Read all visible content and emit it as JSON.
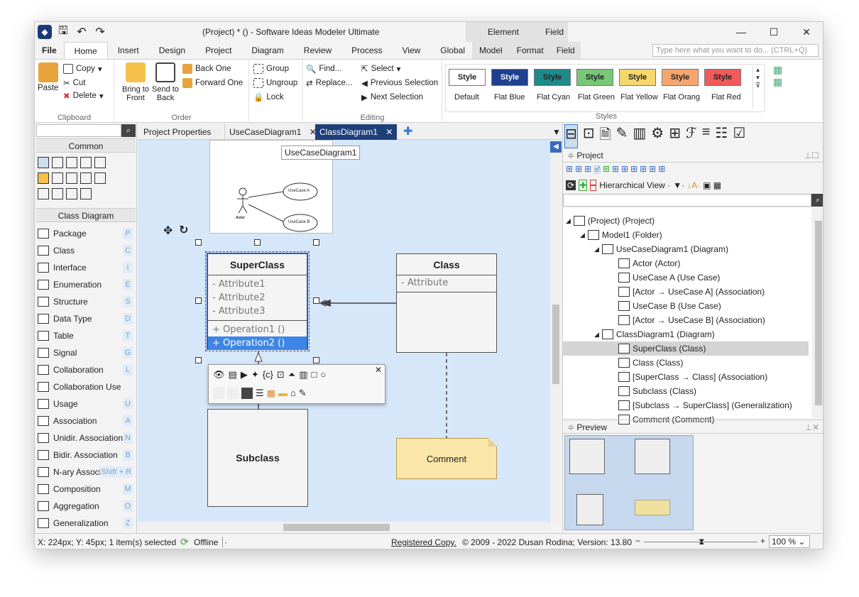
{
  "window": {
    "title": "(Project) * () - Software Ideas Modeler Ultimate",
    "context_element": "Element",
    "context_field": "Field"
  },
  "tabs": [
    "File",
    "Home",
    "Insert",
    "Design",
    "Project",
    "Diagram",
    "Review",
    "Process",
    "View",
    "Global",
    "Model",
    "Format",
    "Field"
  ],
  "search_placeholder": "Type here what you want to do... (CTRL+Q)",
  "ribbon": {
    "clipboard": {
      "paste": "Paste",
      "copy": "Copy",
      "cut": "Cut",
      "delete": "Delete",
      "label": "Clipboard"
    },
    "order": {
      "bring_front": "Bring to Front",
      "send_back": "Send to Back",
      "back_one": "Back One",
      "forward_one": "Forward One",
      "label": "Order"
    },
    "group": {
      "group": "Group",
      "ungroup": "Ungroup",
      "lock": "Lock"
    },
    "editing": {
      "find": "Find...",
      "replace": "Replace...",
      "select": "Select",
      "prev_sel": "Previous Selection",
      "next_sel": "Next Selection",
      "label": "Editing"
    },
    "styles": {
      "label": "Styles",
      "button_text": "Style",
      "items": [
        {
          "name": "Default",
          "bg": "#ffffff",
          "fg": "#222222"
        },
        {
          "name": "Flat Blue",
          "bg": "#1f3f8f",
          "fg": "#ffffff"
        },
        {
          "name": "Flat Cyan",
          "bg": "#1f8a8a",
          "fg": "#222222"
        },
        {
          "name": "Flat Green",
          "bg": "#77c777",
          "fg": "#222222"
        },
        {
          "name": "Flat Yellow",
          "bg": "#f5d76e",
          "fg": "#222222"
        },
        {
          "name": "Flat Orang",
          "bg": "#f5a66e",
          "fg": "#222222"
        },
        {
          "name": "Flat Red",
          "bg": "#ef5a5a",
          "fg": "#222222"
        }
      ]
    }
  },
  "left": {
    "common": "Common",
    "class_diagram": "Class Diagram",
    "items": [
      {
        "label": "Package",
        "key": "P"
      },
      {
        "label": "Class",
        "key": "C"
      },
      {
        "label": "Interface",
        "key": "I"
      },
      {
        "label": "Enumeration",
        "key": "E"
      },
      {
        "label": "Structure",
        "key": "S"
      },
      {
        "label": "Data Type",
        "key": "D"
      },
      {
        "label": "Table",
        "key": "T"
      },
      {
        "label": "Signal",
        "key": "G"
      },
      {
        "label": "Collaboration",
        "key": "L"
      },
      {
        "label": "Collaboration Use",
        "key": ""
      },
      {
        "label": "Usage",
        "key": "U"
      },
      {
        "label": "Association",
        "key": "A"
      },
      {
        "label": "Unidir. Association",
        "key": "N"
      },
      {
        "label": "Bidir. Association",
        "key": "B"
      },
      {
        "label": "N-ary Associ",
        "key": "Shift + R"
      },
      {
        "label": "Composition",
        "key": "M"
      },
      {
        "label": "Aggregation",
        "key": "O"
      },
      {
        "label": "Generalization",
        "key": "Z"
      }
    ]
  },
  "doctabs": {
    "props": "Project Properties",
    "usecase": "UseCaseDiagram1",
    "classdiag": "ClassDiagram1",
    "tooltip": "UseCaseDiagram1"
  },
  "diagram": {
    "superclass": {
      "name": "SuperClass",
      "attrs": [
        "- Attribute1",
        "- Attribute2",
        "- Attribute3"
      ],
      "ops": [
        "+ Operation1 ()",
        "+ Operation2 ()"
      ]
    },
    "class": {
      "name": "Class",
      "attrs": [
        "- Attribute"
      ]
    },
    "subclass": {
      "name": "Subclass"
    },
    "comment": {
      "text": "Comment"
    },
    "thumb": {
      "uc_a": "UseCase A",
      "uc_b": "UseCase B",
      "actor": "Actor"
    }
  },
  "project": {
    "title": "Project",
    "view": "Hierarchical View",
    "tree": [
      {
        "label": "(Project) (Project)",
        "lvl": 0,
        "exp": true
      },
      {
        "label": "Model1 (Folder)",
        "lvl": 1,
        "exp": true
      },
      {
        "label": "UseCaseDiagram1 (Diagram)",
        "lvl": 2,
        "exp": true
      },
      {
        "label": "Actor (Actor)",
        "lvl": 3
      },
      {
        "label": "UseCase A (Use Case)",
        "lvl": 3
      },
      {
        "label": "[Actor → UseCase A] (Association)",
        "lvl": 3
      },
      {
        "label": "UseCase B (Use Case)",
        "lvl": 3
      },
      {
        "label": "[Actor → UseCase B] (Association)",
        "lvl": 3
      },
      {
        "label": "ClassDiagram1 (Diagram)",
        "lvl": 2,
        "exp": true
      },
      {
        "label": "SuperClass (Class)",
        "lvl": 3,
        "sel": true
      },
      {
        "label": "Class (Class)",
        "lvl": 3
      },
      {
        "label": "[SuperClass → Class] (Association)",
        "lvl": 3
      },
      {
        "label": "Subclass (Class)",
        "lvl": 3
      },
      {
        "label": "[Subclass → SuperClass] (Generalization)",
        "lvl": 3
      },
      {
        "label": "Comment (Comment)",
        "lvl": 3
      }
    ],
    "preview": "Preview"
  },
  "status": {
    "pos": "X: 224px; Y: 45px; 1 item(s) selected",
    "offline": "Offline",
    "registered": "Registered Copy.",
    "copyright": "© 2009 - 2022 Dusan Rodina; Version: 13.80",
    "zoom": "100 %"
  }
}
